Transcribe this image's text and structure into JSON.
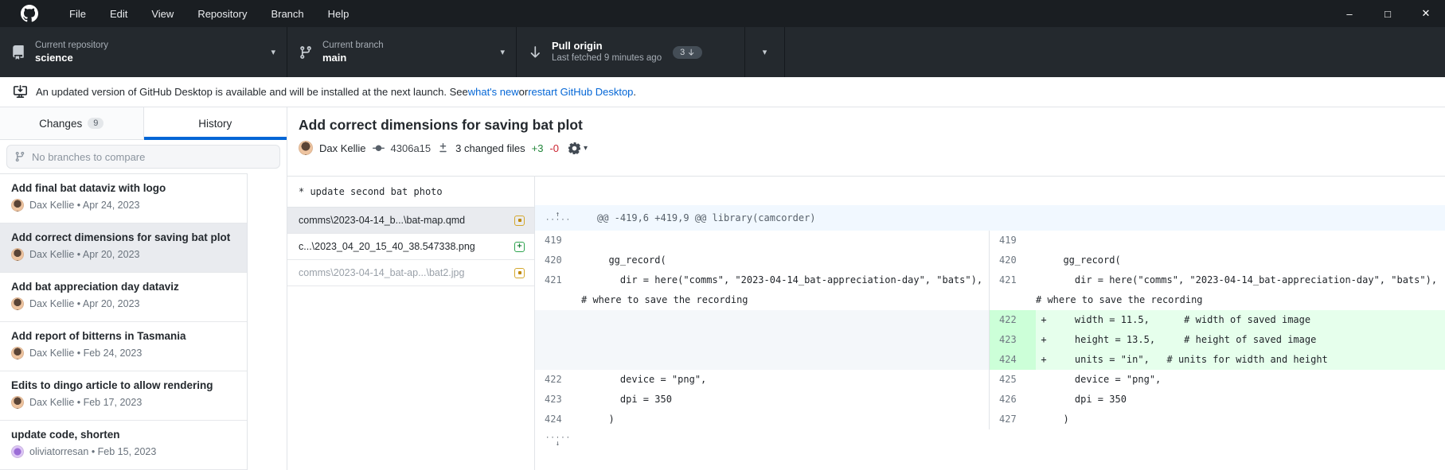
{
  "icons": {
    "minimize": "–",
    "maximize": "□",
    "close": "✕",
    "caret": "▾",
    "dot_separator": "•",
    "dots": "·····",
    "expand_up_arrow": "↑",
    "expand_down_arrow": "↓"
  },
  "menu_bar": {
    "items": [
      "File",
      "Edit",
      "View",
      "Repository",
      "Branch",
      "Help"
    ]
  },
  "toolbar": {
    "repo": {
      "label": "Current repository",
      "value": "science"
    },
    "branch": {
      "label": "Current branch",
      "value": "main"
    },
    "pull": {
      "title": "Pull origin",
      "subtitle": "Last fetched 9 minutes ago",
      "badge_count": "3"
    }
  },
  "banner": {
    "text_before": "An updated version of GitHub Desktop is available and will be installed at the next launch. See ",
    "link_whats_new": "what's new",
    "text_mid": " or ",
    "link_restart": "restart GitHub Desktop",
    "text_after": "."
  },
  "sidebar": {
    "tabs": [
      {
        "label": "Changes",
        "badge": "9",
        "active": false
      },
      {
        "label": "History",
        "active": true
      }
    ],
    "filter_placeholder": "No branches to compare",
    "commits": [
      {
        "title": "Add final bat dataviz with logo",
        "author": "Dax Kellie",
        "date": "Apr 24, 2023",
        "selected": false,
        "avatar": "photo"
      },
      {
        "title": "Add correct dimensions for saving bat plot",
        "author": "Dax Kellie",
        "date": "Apr 20, 2023",
        "selected": true,
        "avatar": "photo"
      },
      {
        "title": "Add bat appreciation day dataviz",
        "author": "Dax Kellie",
        "date": "Apr 20, 2023",
        "selected": false,
        "avatar": "photo"
      },
      {
        "title": "Add report of bitterns in Tasmania",
        "author": "Dax Kellie",
        "date": "Feb 24, 2023",
        "selected": false,
        "avatar": "photo"
      },
      {
        "title": "Edits to dingo article to allow rendering",
        "author": "Dax Kellie",
        "date": "Feb 17, 2023",
        "selected": false,
        "avatar": "photo"
      },
      {
        "title": "update code, shorten",
        "author": "oliviatorresan",
        "date": "Feb 15, 2023",
        "selected": false,
        "avatar": "purple"
      }
    ]
  },
  "commit_detail": {
    "title": "Add correct dimensions for saving bat plot",
    "author": "Dax Kellie",
    "sha": "4306a15",
    "changed_files": "3 changed files",
    "additions": "+3",
    "deletions": "-0",
    "message": "* update second bat photo",
    "files": [
      {
        "path": "comms\\2023-04-14_b...\\bat-map.qmd",
        "status": "modified",
        "selected": true,
        "dim": false
      },
      {
        "path": "c...\\2023_04_20_15_40_38.547338.png",
        "status": "added",
        "selected": false,
        "dim": false
      },
      {
        "path": "comms\\2023-04-14_bat-ap...\\bat2.jpg",
        "status": "modified",
        "selected": false,
        "dim": true
      }
    ]
  },
  "diff": {
    "hunk_header": "@@ -419,6 +419,9 @@ library(camcorder)",
    "rows": [
      {
        "type": "context",
        "ln_old": "419",
        "ln_new": "419",
        "old": "",
        "new": ""
      },
      {
        "type": "context",
        "ln_old": "420",
        "ln_new": "420",
        "old": "  gg_record(",
        "new": "  gg_record("
      },
      {
        "type": "context",
        "ln_old": "421",
        "ln_new": "421",
        "old": "    dir = here(\"comms\", \"2023-04-14_bat-appreciation-day\", \"bats\"),",
        "new": "    dir = here(\"comms\", \"2023-04-14_bat-appreciation-day\", \"bats\"),  "
      },
      {
        "type": "wrap",
        "old": "# where to save the recording",
        "new": "# where to save the recording"
      },
      {
        "type": "added",
        "ln_new": "422",
        "new": "    width = 11.5,      # width of saved image"
      },
      {
        "type": "added",
        "ln_new": "423",
        "new": "    height = 13.5,     # height of saved image"
      },
      {
        "type": "added",
        "ln_new": "424",
        "new": "    units = \"in\",   # units for width and height"
      },
      {
        "type": "context",
        "ln_old": "422",
        "ln_new": "425",
        "old": "    device = \"png\",",
        "new": "    device = \"png\","
      },
      {
        "type": "context",
        "ln_old": "423",
        "ln_new": "426",
        "old": "    dpi = 350",
        "new": "    dpi = 350"
      },
      {
        "type": "context",
        "ln_old": "424",
        "ln_new": "427",
        "old": "  )",
        "new": "  )"
      }
    ]
  },
  "colors": {
    "accent_blue": "#0366d6",
    "added_bg": "#e6ffec",
    "added_gutter": "#ccffd8",
    "modified_yellow": "#d4a72c",
    "added_green": "#2da44e",
    "plus_green": "#22863a",
    "minus_red": "#cb2431",
    "titlebar_bg": "#1a1e22",
    "toolbar_bg": "#24292e"
  }
}
